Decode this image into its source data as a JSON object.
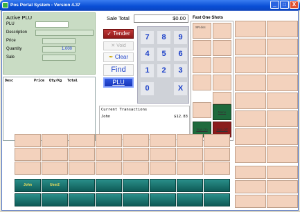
{
  "window": {
    "title": "Pos Portal System - Version 4.37",
    "minimize": "_",
    "maximize": "□",
    "close": "X"
  },
  "active_plu": {
    "title": "Active PLU",
    "fields": [
      {
        "label": "PLU",
        "value": ""
      },
      {
        "label": "Description",
        "value": ""
      },
      {
        "label": "Price",
        "value": ""
      },
      {
        "label": "Quantity",
        "value": "1.000"
      },
      {
        "label": "Sale",
        "value": ""
      }
    ]
  },
  "receipt": {
    "headers": [
      "Desc",
      "Price",
      "Qty/Kg",
      "Total"
    ]
  },
  "sale_total": {
    "label": "Sale Total",
    "value": "$0.00"
  },
  "actions": {
    "tender": "Tender",
    "void": "Void",
    "clear": "Clear",
    "find": "Find",
    "plu": "PLU"
  },
  "keypad": [
    "7",
    "8",
    "9",
    "4",
    "5",
    "6",
    "1",
    "2",
    "3",
    "0",
    "X"
  ],
  "transactions": {
    "title": "Current Transactions",
    "rows": [
      {
        "name": "John",
        "amount": "$12.83"
      }
    ]
  },
  "fast_one_shots": {
    "label": "Fast One Shots",
    "first_item": "SR.doc",
    "menu": "Menu",
    "sign_on": "Sign On",
    "sign_off": "Sign Off"
  },
  "bottom_buttons": {
    "john": "John",
    "user2": "User2"
  },
  "colors": {
    "peach": "#f3d2bd",
    "teal": "#1e7a75",
    "panel_green": "#c9dcc4",
    "title_blue": "#0a4fd6"
  }
}
